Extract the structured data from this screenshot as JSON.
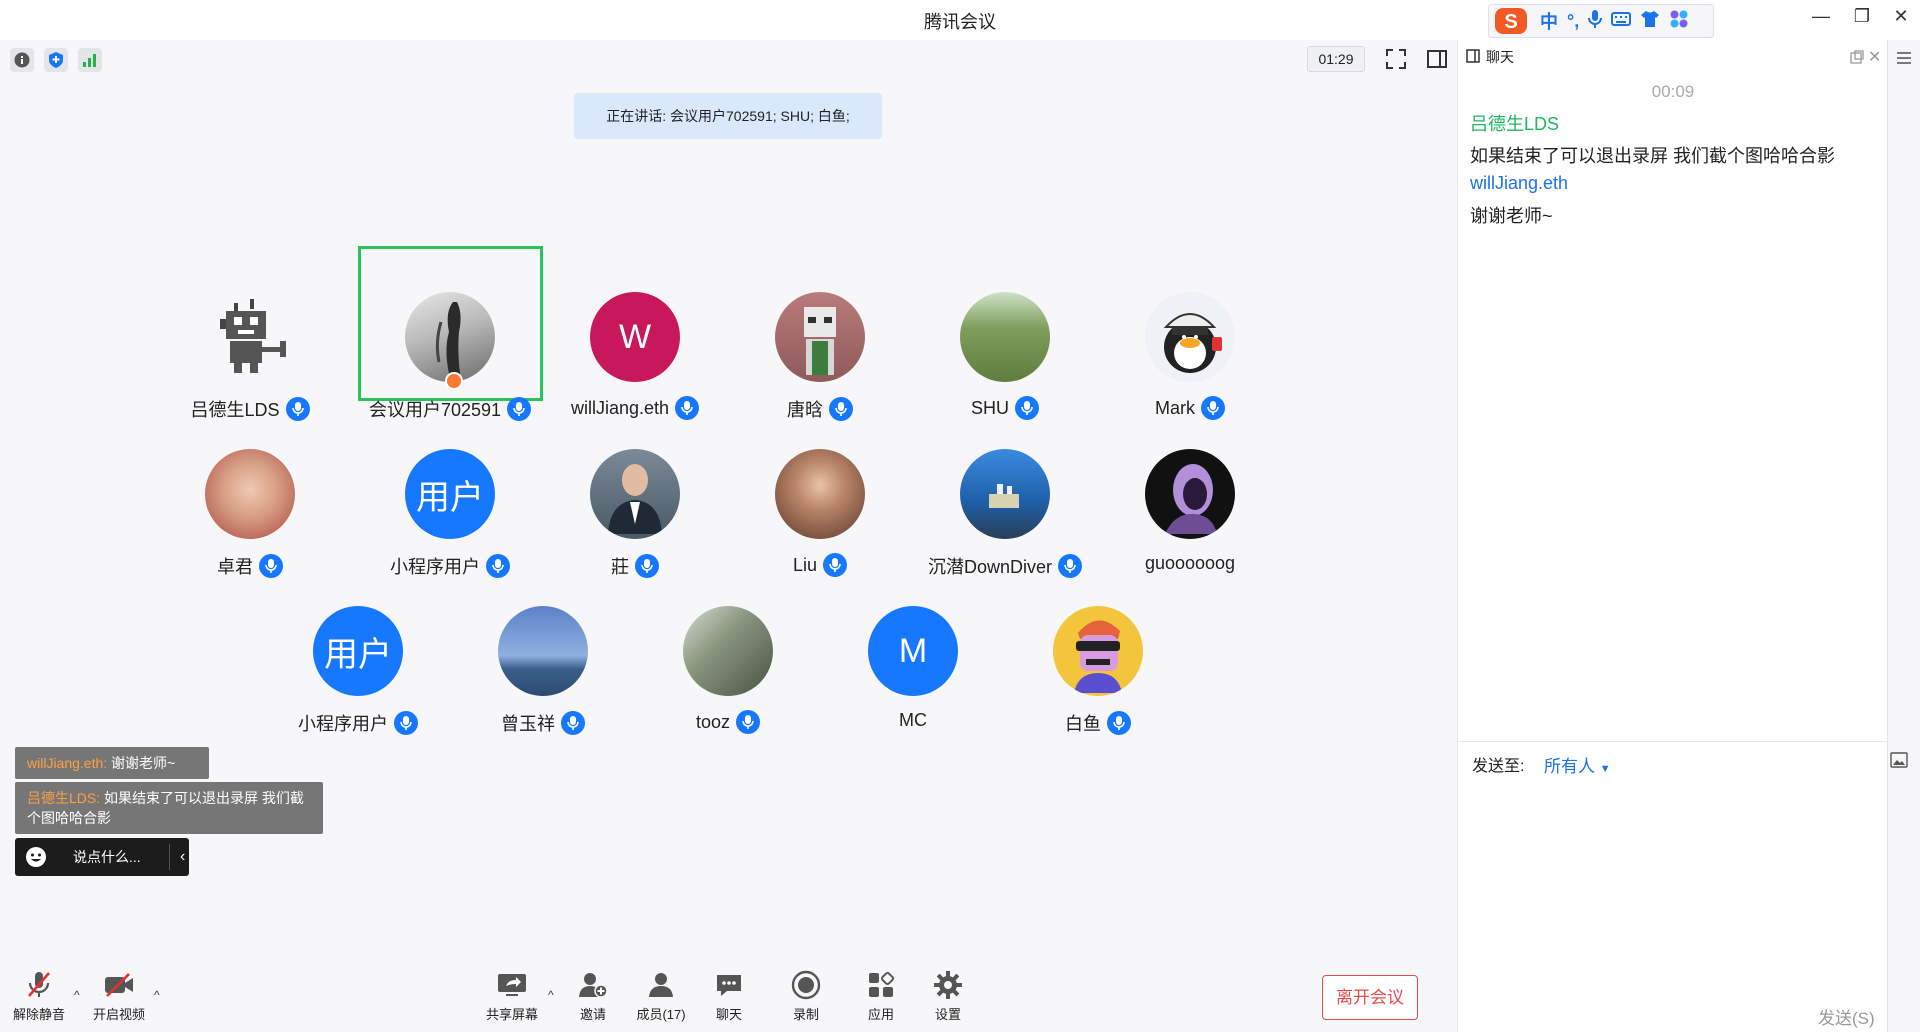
{
  "window": {
    "title": "腾讯会议",
    "controls": [
      "—",
      "❐",
      "✕"
    ]
  },
  "ime": {
    "items": [
      "中",
      "°,",
      "mic",
      "keyboard",
      "shirt",
      "apps"
    ]
  },
  "meeting": {
    "timer": "01:29",
    "speaking_banner": "正在讲话: 会议用户702591; SHU; 白鱼;"
  },
  "participants": [
    {
      "name": "吕德生LDS",
      "avatar_type": "robot",
      "color": "#ffffff",
      "mic": true
    },
    {
      "name": "会议用户702591",
      "avatar_type": "photo-gray",
      "color": "#9c9c9c",
      "mic": true,
      "active": true
    },
    {
      "name": "willJiang.eth",
      "avatar_type": "letter",
      "letter": "W",
      "color": "#c8175a",
      "mic": true
    },
    {
      "name": "唐晗",
      "avatar_type": "photo",
      "color": "#a96a6a",
      "mic": true
    },
    {
      "name": "SHU",
      "avatar_type": "photo",
      "color": "#6f8c4c",
      "mic": true
    },
    {
      "name": "Mark",
      "avatar_type": "penguin",
      "color": "#eef1f6",
      "mic": true
    },
    {
      "name": "卓君",
      "avatar_type": "photo",
      "color": "#c48a77",
      "mic": true
    },
    {
      "name": "小程序用户",
      "avatar_type": "text",
      "letter": "用户",
      "color": "#1677ff",
      "mic": true
    },
    {
      "name": "莊",
      "avatar_type": "photo",
      "color": "#5b6d7c",
      "mic": true
    },
    {
      "name": "Liu",
      "avatar_type": "photo",
      "color": "#6c4b3c",
      "mic": true
    },
    {
      "name": "沉潜DownDiver",
      "avatar_type": "photo",
      "color": "#2f7ac6",
      "mic": true
    },
    {
      "name": "guoooooog",
      "avatar_type": "photo",
      "color": "#2b1b38",
      "mic": false
    },
    {
      "name": "小程序用户",
      "avatar_type": "text",
      "letter": "用户",
      "color": "#1677ff",
      "mic": true
    },
    {
      "name": "曾玉祥",
      "avatar_type": "photo",
      "color": "#4e74b6",
      "mic": true
    },
    {
      "name": "tooz",
      "avatar_type": "photo",
      "color": "#707a66",
      "mic": true
    },
    {
      "name": "MC",
      "avatar_type": "letter",
      "letter": "M",
      "color": "#1677ff",
      "mic": false
    },
    {
      "name": "白鱼",
      "avatar_type": "photo",
      "color": "#f2c53d",
      "mic": true
    }
  ],
  "overlay_chat": [
    {
      "who": "willJiang.eth:",
      "text": "谢谢老师~"
    },
    {
      "who": "吕德生LDS:",
      "text": "如果结束了可以退出录屏 我们截个图哈哈合影"
    }
  ],
  "say_box": {
    "placeholder": "说点什么...",
    "collapse": "‹"
  },
  "toolbar": {
    "unmute": "解除静音",
    "start_video": "开启视频",
    "share_screen": "共享屏幕",
    "invite": "邀请",
    "members": "成员(17)",
    "chat": "聊天",
    "record": "录制",
    "apps": "应用",
    "settings": "设置",
    "leave": "离开会议"
  },
  "chat_panel": {
    "title": "聊天",
    "time": "00:09",
    "messages": [
      {
        "name": "吕德生LDS",
        "name_color": "#1fb760",
        "text": "如果结束了可以退出录屏 我们截个图哈哈合影"
      },
      {
        "name": "willJiang.eth",
        "name_color": "#1a73e8",
        "text": "谢谢老师~"
      }
    ],
    "send_to_label": "发送至:",
    "send_to_value": "所有人",
    "send_button": "发送(S)"
  }
}
